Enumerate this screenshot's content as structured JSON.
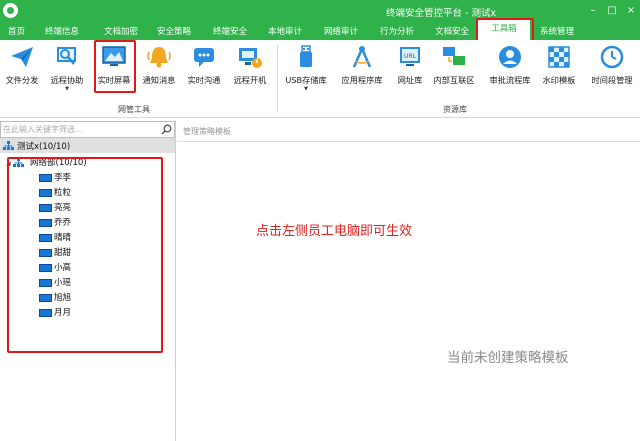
{
  "titlebar": {
    "title": "终端安全管控平台 - 测试x"
  },
  "menubar": {
    "items": [
      "首页",
      "终端信息",
      "文档加密",
      "安全策略",
      "终端安全",
      "本地审计",
      "网络审计",
      "行为分析",
      "文档安全",
      "工具箱",
      "系统管理"
    ],
    "active": "工具箱"
  },
  "toolbar": {
    "tools": [
      {
        "label": "文件分发",
        "icon": "paper-plane-icon"
      },
      {
        "label": "远程协助",
        "icon": "remote-assist-icon"
      },
      {
        "label": "实时屏幕",
        "icon": "screen-icon"
      },
      {
        "label": "通知消息",
        "icon": "bell-icon"
      },
      {
        "label": "实时沟通",
        "icon": "chat-icon"
      },
      {
        "label": "远程开机",
        "icon": "power-on-icon"
      },
      {
        "label": "USB存储库",
        "icon": "usb-icon"
      },
      {
        "label": "应用程序库",
        "icon": "compass-icon"
      },
      {
        "label": "网址库",
        "icon": "url-library-icon"
      },
      {
        "label": "内部互联区",
        "icon": "intranet-icon"
      },
      {
        "label": "审批流程库",
        "icon": "approval-icon"
      },
      {
        "label": "水印模板",
        "icon": "watermark-icon"
      },
      {
        "label": "时间段管理",
        "icon": "clock-icon"
      }
    ],
    "groups": [
      "网管工具",
      "资源库"
    ]
  },
  "sidebar": {
    "search_placeholder": "在此输入关键字筛选...",
    "root": "测试x(10/10)",
    "department": "网络部(10/10)",
    "employees": [
      "李李",
      "粒粒",
      "亮亮",
      "乔乔",
      "晴晴",
      "甜甜",
      "小高",
      "小瑶",
      "旭旭",
      "月月"
    ]
  },
  "main": {
    "header": "管理策略模板",
    "hint": "点击左侧员工电脑即可生效",
    "empty_text": "当前未创建策略模板"
  },
  "colors": {
    "accent": "#2fb24a",
    "highlight": "#e01818"
  }
}
